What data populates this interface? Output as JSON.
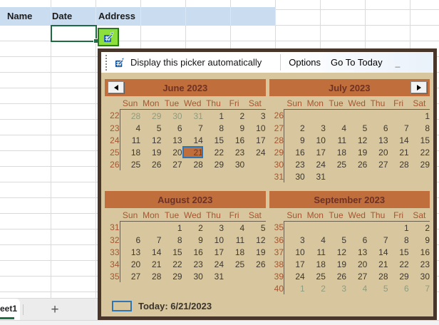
{
  "spreadsheet": {
    "header": {
      "columns": [
        "Name",
        "Date",
        "Address"
      ]
    },
    "tabs": {
      "active_label": "eet1",
      "add_label": "+"
    }
  },
  "picker": {
    "toolbar": {
      "auto_label": "Display this picker automatically",
      "options_label": "Options",
      "goto_label": "Go To Today",
      "grip_char": "_"
    },
    "day_names": [
      "Sun",
      "Mon",
      "Tue",
      "Wed",
      "Thu",
      "Fri",
      "Sat"
    ],
    "today_label": "Today: 6/21/2023",
    "selected_date": "21",
    "colors": {
      "popup_border": "#49362a",
      "calendar_bg": "#d8c79e",
      "month_bar": "#bf6e3c",
      "month_title_text": "#6e3125",
      "accent_text": "#a4552e",
      "date_text": "#3c372f",
      "muted_date_text": "#8e9b7e",
      "selection_border_blue": "#2e75b6",
      "excel_green": "#1e6b41",
      "picker_button_green": "#8de03c",
      "header_blue": "#c9dcf0"
    },
    "months": [
      {
        "title": "June 2023",
        "nav": "prev",
        "weeks": [
          {
            "num": "22",
            "days": [
              {
                "v": "28",
                "muted": true
              },
              {
                "v": "29",
                "muted": true
              },
              {
                "v": "30",
                "muted": true
              },
              {
                "v": "31",
                "muted": true
              },
              {
                "v": "1"
              },
              {
                "v": "2"
              },
              {
                "v": "3"
              }
            ]
          },
          {
            "num": "23",
            "days": [
              {
                "v": "4"
              },
              {
                "v": "5"
              },
              {
                "v": "6"
              },
              {
                "v": "7"
              },
              {
                "v": "8"
              },
              {
                "v": "9"
              },
              {
                "v": "10"
              }
            ]
          },
          {
            "num": "24",
            "days": [
              {
                "v": "11"
              },
              {
                "v": "12"
              },
              {
                "v": "13"
              },
              {
                "v": "14"
              },
              {
                "v": "15"
              },
              {
                "v": "16"
              },
              {
                "v": "17"
              }
            ]
          },
          {
            "num": "25",
            "days": [
              {
                "v": "18"
              },
              {
                "v": "19"
              },
              {
                "v": "20"
              },
              {
                "v": "21",
                "selected": true
              },
              {
                "v": "22"
              },
              {
                "v": "23"
              },
              {
                "v": "24"
              }
            ]
          },
          {
            "num": "26",
            "days": [
              {
                "v": "25"
              },
              {
                "v": "26"
              },
              {
                "v": "27"
              },
              {
                "v": "28"
              },
              {
                "v": "29"
              },
              {
                "v": "30"
              },
              {
                "v": ""
              }
            ]
          }
        ]
      },
      {
        "title": "July 2023",
        "nav": "next",
        "weeks": [
          {
            "num": "26",
            "days": [
              {
                "v": ""
              },
              {
                "v": ""
              },
              {
                "v": ""
              },
              {
                "v": ""
              },
              {
                "v": ""
              },
              {
                "v": ""
              },
              {
                "v": "1"
              }
            ]
          },
          {
            "num": "27",
            "days": [
              {
                "v": "2"
              },
              {
                "v": "3"
              },
              {
                "v": "4"
              },
              {
                "v": "5"
              },
              {
                "v": "6"
              },
              {
                "v": "7"
              },
              {
                "v": "8"
              }
            ]
          },
          {
            "num": "28",
            "days": [
              {
                "v": "9"
              },
              {
                "v": "10"
              },
              {
                "v": "11"
              },
              {
                "v": "12"
              },
              {
                "v": "13"
              },
              {
                "v": "14"
              },
              {
                "v": "15"
              }
            ]
          },
          {
            "num": "29",
            "days": [
              {
                "v": "16"
              },
              {
                "v": "17"
              },
              {
                "v": "18"
              },
              {
                "v": "19"
              },
              {
                "v": "20"
              },
              {
                "v": "21"
              },
              {
                "v": "22"
              }
            ]
          },
          {
            "num": "30",
            "days": [
              {
                "v": "23"
              },
              {
                "v": "24"
              },
              {
                "v": "25"
              },
              {
                "v": "26"
              },
              {
                "v": "27"
              },
              {
                "v": "28"
              },
              {
                "v": "29"
              }
            ]
          },
          {
            "num": "31",
            "days": [
              {
                "v": "30"
              },
              {
                "v": "31"
              },
              {
                "v": ""
              },
              {
                "v": ""
              },
              {
                "v": ""
              },
              {
                "v": ""
              },
              {
                "v": ""
              }
            ]
          }
        ]
      },
      {
        "title": "August 2023",
        "nav": null,
        "weeks": [
          {
            "num": "31",
            "days": [
              {
                "v": ""
              },
              {
                "v": ""
              },
              {
                "v": "1"
              },
              {
                "v": "2"
              },
              {
                "v": "3"
              },
              {
                "v": "4"
              },
              {
                "v": "5"
              }
            ]
          },
          {
            "num": "32",
            "days": [
              {
                "v": "6"
              },
              {
                "v": "7"
              },
              {
                "v": "8"
              },
              {
                "v": "9"
              },
              {
                "v": "10"
              },
              {
                "v": "11"
              },
              {
                "v": "12"
              }
            ]
          },
          {
            "num": "33",
            "days": [
              {
                "v": "13"
              },
              {
                "v": "14"
              },
              {
                "v": "15"
              },
              {
                "v": "16"
              },
              {
                "v": "17"
              },
              {
                "v": "18"
              },
              {
                "v": "19"
              }
            ]
          },
          {
            "num": "34",
            "days": [
              {
                "v": "20"
              },
              {
                "v": "21"
              },
              {
                "v": "22"
              },
              {
                "v": "23"
              },
              {
                "v": "24"
              },
              {
                "v": "25"
              },
              {
                "v": "26"
              }
            ]
          },
          {
            "num": "35",
            "days": [
              {
                "v": "27"
              },
              {
                "v": "28"
              },
              {
                "v": "29"
              },
              {
                "v": "30"
              },
              {
                "v": "31"
              },
              {
                "v": ""
              },
              {
                "v": ""
              }
            ]
          }
        ]
      },
      {
        "title": "September 2023",
        "nav": null,
        "weeks": [
          {
            "num": "35",
            "days": [
              {
                "v": ""
              },
              {
                "v": ""
              },
              {
                "v": ""
              },
              {
                "v": ""
              },
              {
                "v": ""
              },
              {
                "v": "1"
              },
              {
                "v": "2"
              }
            ]
          },
          {
            "num": "36",
            "days": [
              {
                "v": "3"
              },
              {
                "v": "4"
              },
              {
                "v": "5"
              },
              {
                "v": "6"
              },
              {
                "v": "7"
              },
              {
                "v": "8"
              },
              {
                "v": "9"
              }
            ]
          },
          {
            "num": "37",
            "days": [
              {
                "v": "10"
              },
              {
                "v": "11"
              },
              {
                "v": "12"
              },
              {
                "v": "13"
              },
              {
                "v": "14"
              },
              {
                "v": "15"
              },
              {
                "v": "16"
              }
            ]
          },
          {
            "num": "38",
            "days": [
              {
                "v": "17"
              },
              {
                "v": "18"
              },
              {
                "v": "19"
              },
              {
                "v": "20"
              },
              {
                "v": "21"
              },
              {
                "v": "22"
              },
              {
                "v": "23"
              }
            ]
          },
          {
            "num": "39",
            "days": [
              {
                "v": "24"
              },
              {
                "v": "25"
              },
              {
                "v": "26"
              },
              {
                "v": "27"
              },
              {
                "v": "28"
              },
              {
                "v": "29"
              },
              {
                "v": "30"
              }
            ]
          },
          {
            "num": "40",
            "days": [
              {
                "v": "1",
                "muted": true
              },
              {
                "v": "2",
                "muted": true
              },
              {
                "v": "3",
                "muted": true
              },
              {
                "v": "4",
                "muted": true
              },
              {
                "v": "5",
                "muted": true
              },
              {
                "v": "6",
                "muted": true
              },
              {
                "v": "7",
                "muted": true
              }
            ]
          }
        ]
      }
    ]
  }
}
